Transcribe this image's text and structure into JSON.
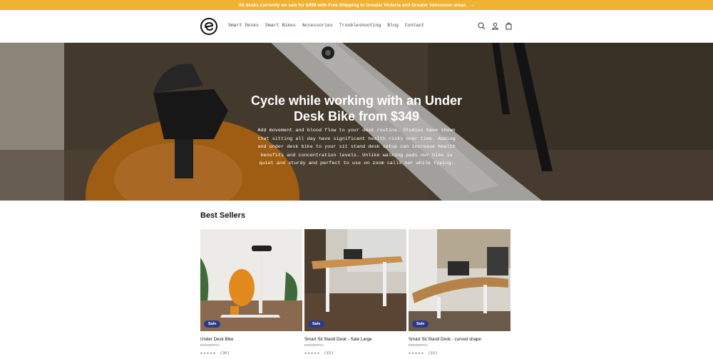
{
  "announcement": {
    "text": "All desks currently on sale for $499 with Free Shipping to Greater Victoria and Greater Vancouver areas",
    "arrow": "→"
  },
  "header": {
    "logo_icon": "ergonomyx-circle-logo",
    "nav": [
      "Smart Desks",
      "Smart Bikes",
      "Accessories",
      "Troubleshooting",
      "Blog",
      "Contact"
    ],
    "icons": [
      "search-icon",
      "account-icon",
      "cart-icon"
    ]
  },
  "hero": {
    "title": "Cycle while working with an Under Desk Bike from $349",
    "body": "Add movement and blood flow to your desk routine. Studies have shown that sitting all day have significant health risks over time. Adding and under desk bike to your sit stand desk setup can increase health benefits and concentration levels. Unlike walking pads our bike is quiet and sturdy and perfect to use on zoom calls our while typing."
  },
  "best_sellers": {
    "title": "Best Sellers",
    "products": [
      {
        "badge": "Sale",
        "title": "Under Desk Bike",
        "vendor": "ERGONOMYX",
        "stars": "★★★★★",
        "reviews": "(36)"
      },
      {
        "badge": "Sale",
        "title": "Smart Sit Stand Desk - Sale Large",
        "vendor": "ERGONOMYX",
        "stars": "★★★★★",
        "reviews": "(15)"
      },
      {
        "badge": "Sale",
        "title": "Smart Sit Stand Desk - curved shape",
        "vendor": "ERGONOMYX",
        "stars": "★★★★★",
        "reviews": "(15)"
      }
    ]
  },
  "colors": {
    "announcement_bg": "#f0b232",
    "sale_badge": "#2c3a8c",
    "bike_orange": "#e28a1e"
  }
}
